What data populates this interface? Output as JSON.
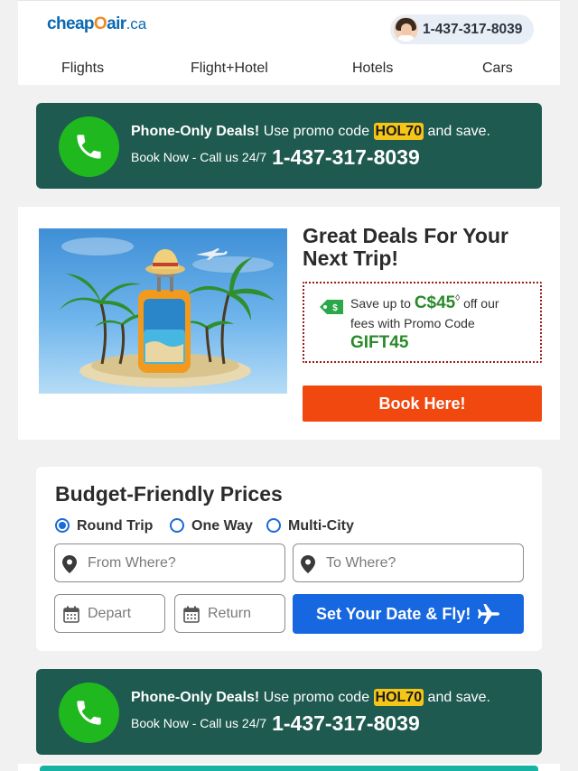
{
  "header": {
    "logo": {
      "main": "cheap",
      "o": "O",
      "rest": "air",
      "tld": ".ca"
    },
    "phone": "1-437-317-8039"
  },
  "nav": [
    "Flights",
    "Flight+Hotel",
    "Hotels",
    "Cars"
  ],
  "promo": {
    "bold": "Phone-Only Deals!",
    "text_before_code": " Use promo code ",
    "code": "HOL70",
    "text_after_code": " and save.",
    "book_now": "Book Now - Call us 24/7",
    "phone": "1-437-317-8039"
  },
  "deal": {
    "title": "Great Deals For Your Next Trip!",
    "save_prefix": "Save up to ",
    "amount": "C$45",
    "amount_symbol": "◊",
    "save_suffix": " off our",
    "fees_text": "fees with Promo Code",
    "promo_code": "GIFT45",
    "book_button": "Book Here!"
  },
  "search": {
    "title": "Budget-Friendly Prices",
    "trip_types": [
      {
        "label": "Round Trip",
        "selected": true
      },
      {
        "label": "One Way",
        "selected": false
      },
      {
        "label": "Multi-City",
        "selected": false
      }
    ],
    "from_placeholder": "From Where?",
    "to_placeholder": "To Where?",
    "depart_placeholder": "Depart",
    "return_placeholder": "Return",
    "submit_label": "Set Your Date & Fly!"
  },
  "colors": {
    "promo_bg": "#1f5a50",
    "promo_code_bg": "#f5c518",
    "call_circle": "#1fb81f",
    "book_button": "#f0480f",
    "submit_button": "#1767e0",
    "accent_green": "#2a8a2a"
  }
}
